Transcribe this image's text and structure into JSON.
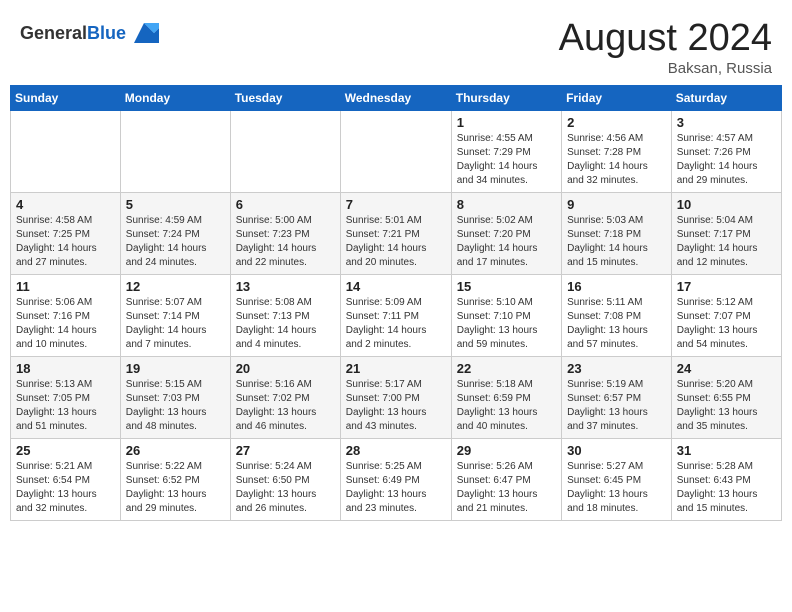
{
  "header": {
    "logo": {
      "general": "General",
      "blue": "Blue"
    },
    "month_title": "August 2024",
    "location": "Baksan, Russia"
  },
  "weekdays": [
    "Sunday",
    "Monday",
    "Tuesday",
    "Wednesday",
    "Thursday",
    "Friday",
    "Saturday"
  ],
  "weeks": [
    [
      {
        "day": "",
        "info": ""
      },
      {
        "day": "",
        "info": ""
      },
      {
        "day": "",
        "info": ""
      },
      {
        "day": "",
        "info": ""
      },
      {
        "day": "1",
        "info": "Sunrise: 4:55 AM\nSunset: 7:29 PM\nDaylight: 14 hours\nand 34 minutes."
      },
      {
        "day": "2",
        "info": "Sunrise: 4:56 AM\nSunset: 7:28 PM\nDaylight: 14 hours\nand 32 minutes."
      },
      {
        "day": "3",
        "info": "Sunrise: 4:57 AM\nSunset: 7:26 PM\nDaylight: 14 hours\nand 29 minutes."
      }
    ],
    [
      {
        "day": "4",
        "info": "Sunrise: 4:58 AM\nSunset: 7:25 PM\nDaylight: 14 hours\nand 27 minutes."
      },
      {
        "day": "5",
        "info": "Sunrise: 4:59 AM\nSunset: 7:24 PM\nDaylight: 14 hours\nand 24 minutes."
      },
      {
        "day": "6",
        "info": "Sunrise: 5:00 AM\nSunset: 7:23 PM\nDaylight: 14 hours\nand 22 minutes."
      },
      {
        "day": "7",
        "info": "Sunrise: 5:01 AM\nSunset: 7:21 PM\nDaylight: 14 hours\nand 20 minutes."
      },
      {
        "day": "8",
        "info": "Sunrise: 5:02 AM\nSunset: 7:20 PM\nDaylight: 14 hours\nand 17 minutes."
      },
      {
        "day": "9",
        "info": "Sunrise: 5:03 AM\nSunset: 7:18 PM\nDaylight: 14 hours\nand 15 minutes."
      },
      {
        "day": "10",
        "info": "Sunrise: 5:04 AM\nSunset: 7:17 PM\nDaylight: 14 hours\nand 12 minutes."
      }
    ],
    [
      {
        "day": "11",
        "info": "Sunrise: 5:06 AM\nSunset: 7:16 PM\nDaylight: 14 hours\nand 10 minutes."
      },
      {
        "day": "12",
        "info": "Sunrise: 5:07 AM\nSunset: 7:14 PM\nDaylight: 14 hours\nand 7 minutes."
      },
      {
        "day": "13",
        "info": "Sunrise: 5:08 AM\nSunset: 7:13 PM\nDaylight: 14 hours\nand 4 minutes."
      },
      {
        "day": "14",
        "info": "Sunrise: 5:09 AM\nSunset: 7:11 PM\nDaylight: 14 hours\nand 2 minutes."
      },
      {
        "day": "15",
        "info": "Sunrise: 5:10 AM\nSunset: 7:10 PM\nDaylight: 13 hours\nand 59 minutes."
      },
      {
        "day": "16",
        "info": "Sunrise: 5:11 AM\nSunset: 7:08 PM\nDaylight: 13 hours\nand 57 minutes."
      },
      {
        "day": "17",
        "info": "Sunrise: 5:12 AM\nSunset: 7:07 PM\nDaylight: 13 hours\nand 54 minutes."
      }
    ],
    [
      {
        "day": "18",
        "info": "Sunrise: 5:13 AM\nSunset: 7:05 PM\nDaylight: 13 hours\nand 51 minutes."
      },
      {
        "day": "19",
        "info": "Sunrise: 5:15 AM\nSunset: 7:03 PM\nDaylight: 13 hours\nand 48 minutes."
      },
      {
        "day": "20",
        "info": "Sunrise: 5:16 AM\nSunset: 7:02 PM\nDaylight: 13 hours\nand 46 minutes."
      },
      {
        "day": "21",
        "info": "Sunrise: 5:17 AM\nSunset: 7:00 PM\nDaylight: 13 hours\nand 43 minutes."
      },
      {
        "day": "22",
        "info": "Sunrise: 5:18 AM\nSunset: 6:59 PM\nDaylight: 13 hours\nand 40 minutes."
      },
      {
        "day": "23",
        "info": "Sunrise: 5:19 AM\nSunset: 6:57 PM\nDaylight: 13 hours\nand 37 minutes."
      },
      {
        "day": "24",
        "info": "Sunrise: 5:20 AM\nSunset: 6:55 PM\nDaylight: 13 hours\nand 35 minutes."
      }
    ],
    [
      {
        "day": "25",
        "info": "Sunrise: 5:21 AM\nSunset: 6:54 PM\nDaylight: 13 hours\nand 32 minutes."
      },
      {
        "day": "26",
        "info": "Sunrise: 5:22 AM\nSunset: 6:52 PM\nDaylight: 13 hours\nand 29 minutes."
      },
      {
        "day": "27",
        "info": "Sunrise: 5:24 AM\nSunset: 6:50 PM\nDaylight: 13 hours\nand 26 minutes."
      },
      {
        "day": "28",
        "info": "Sunrise: 5:25 AM\nSunset: 6:49 PM\nDaylight: 13 hours\nand 23 minutes."
      },
      {
        "day": "29",
        "info": "Sunrise: 5:26 AM\nSunset: 6:47 PM\nDaylight: 13 hours\nand 21 minutes."
      },
      {
        "day": "30",
        "info": "Sunrise: 5:27 AM\nSunset: 6:45 PM\nDaylight: 13 hours\nand 18 minutes."
      },
      {
        "day": "31",
        "info": "Sunrise: 5:28 AM\nSunset: 6:43 PM\nDaylight: 13 hours\nand 15 minutes."
      }
    ]
  ]
}
